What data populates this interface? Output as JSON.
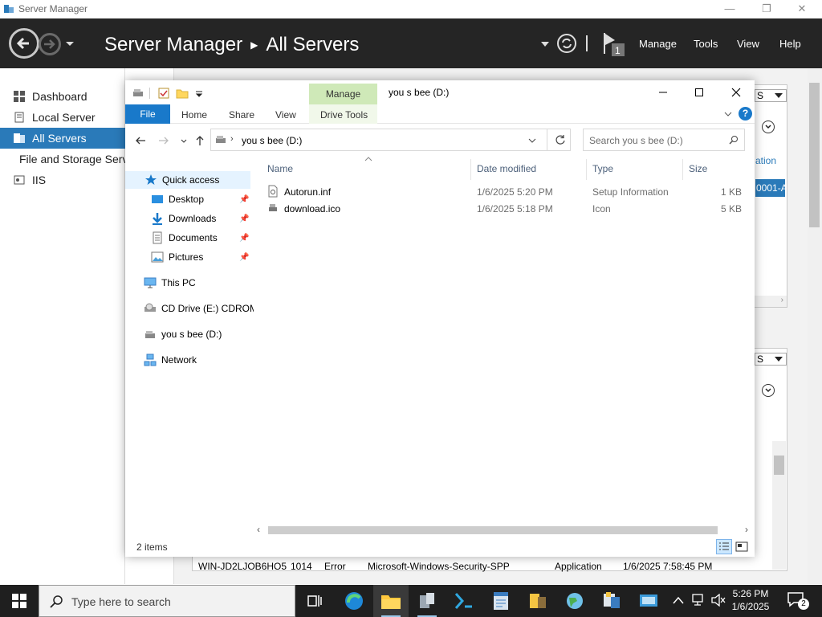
{
  "server_manager": {
    "window_title": "Server Manager",
    "breadcrumb": {
      "app": "Server Manager",
      "page": "All Servers"
    },
    "notification_count": "1",
    "menu": {
      "manage": "Manage",
      "tools": "Tools",
      "view": "View",
      "help": "Help"
    },
    "sidebar": [
      {
        "label": "Dashboard",
        "icon": "dashboard-icon",
        "active": false
      },
      {
        "label": "Local Server",
        "icon": "local-server-icon",
        "active": false
      },
      {
        "label": "All Servers",
        "icon": "all-servers-icon",
        "active": true
      },
      {
        "label": "File and Storage Services",
        "icon": "storage-icon",
        "active": false
      },
      {
        "label": "IIS",
        "icon": "iis-icon",
        "active": false
      }
    ],
    "tasks_stub_1": "S",
    "tasks_stub_2": "S",
    "column_stub": "ation",
    "selected_row_stub": "0001-A",
    "event_row": {
      "server": "WIN-JD2LJOB6HO5",
      "id": "1014",
      "severity": "Error",
      "source": "Microsoft-Windows-Security-SPP",
      "log": "Application",
      "date": "1/6/2025 7:58:45 PM"
    }
  },
  "explorer": {
    "title": "you s bee (D:)",
    "contextual_tab_group": "Manage",
    "ribbon_tabs": {
      "file": "File",
      "home": "Home",
      "share": "Share",
      "view": "View",
      "drive_tools": "Drive Tools"
    },
    "help_label": "?",
    "address": "you s bee (D:)",
    "search_placeholder": "Search you s bee (D:)",
    "nav": {
      "quick_access": "Quick access",
      "pinned": [
        {
          "label": "Desktop",
          "icon": "desktop-folder-icon"
        },
        {
          "label": "Downloads",
          "icon": "downloads-folder-icon"
        },
        {
          "label": "Documents",
          "icon": "documents-folder-icon"
        },
        {
          "label": "Pictures",
          "icon": "pictures-folder-icon"
        }
      ],
      "this_pc": "This PC",
      "cd_drive": "CD Drive (E:) CDROM",
      "d_drive": "you s bee (D:)",
      "network": "Network"
    },
    "columns": {
      "name": "Name",
      "date": "Date modified",
      "type": "Type",
      "size": "Size"
    },
    "files": [
      {
        "name": "Autorun.inf",
        "date": "1/6/2025 5:20 PM",
        "type": "Setup Information",
        "size": "1 KB",
        "icon": "setup-info-file-icon"
      },
      {
        "name": "download.ico",
        "date": "1/6/2025 5:18 PM",
        "type": "Icon",
        "size": "5 KB",
        "icon": "icon-file-icon"
      }
    ],
    "status": "2 items"
  },
  "taskbar": {
    "search_placeholder": "Type here to search",
    "clock_time": "5:26 PM",
    "clock_date": "1/6/2025",
    "notification_count": "2"
  },
  "colors": {
    "accent_blue": "#1979ca",
    "sm_selected": "#2a7ab9",
    "sm_header": "#252525",
    "manage_tab_green": "#cfe9b8",
    "taskbar": "#1f1f1f"
  }
}
